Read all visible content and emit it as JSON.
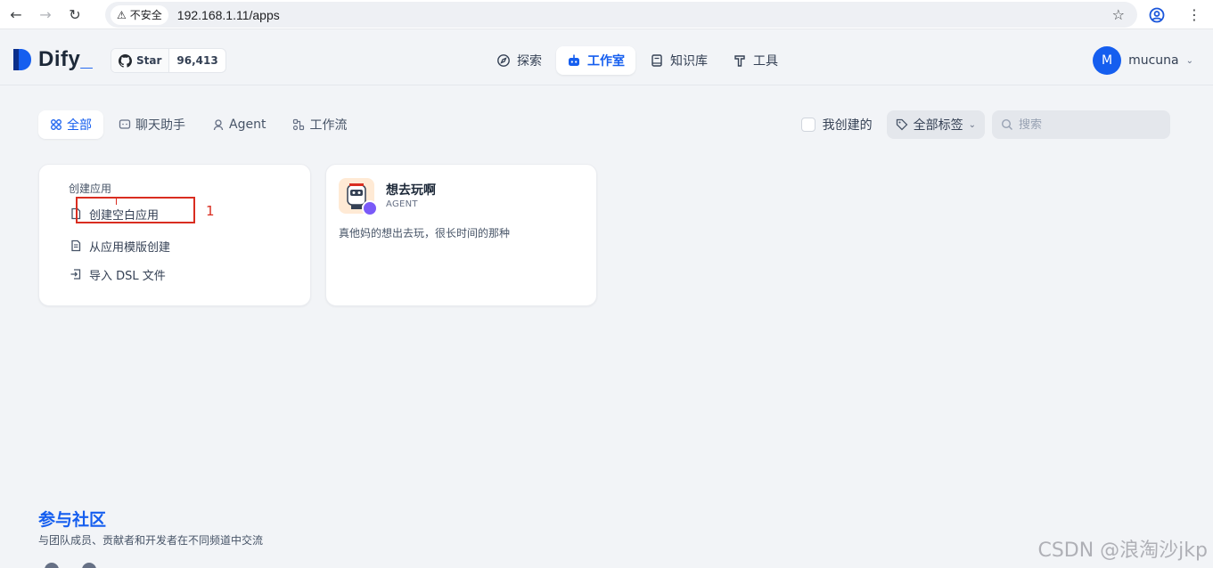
{
  "browser": {
    "security_label": "不安全",
    "url": "192.168.1.11/apps"
  },
  "header": {
    "logo_text": "Dify",
    "logo_suffix": "_",
    "github_star_label": "Star",
    "github_star_count": "96,413",
    "nav": [
      {
        "label": "探索",
        "icon": "compass-icon",
        "active": false
      },
      {
        "label": "工作室",
        "icon": "robot-icon",
        "active": true
      },
      {
        "label": "知识库",
        "icon": "book-icon",
        "active": false
      },
      {
        "label": "工具",
        "icon": "hammer-icon",
        "active": false
      }
    ],
    "user": {
      "avatar_letter": "M",
      "name": "mucuna"
    }
  },
  "tabs": [
    {
      "label": "全部",
      "icon": "grid-icon",
      "active": true
    },
    {
      "label": "聊天助手",
      "icon": "chat-icon",
      "active": false
    },
    {
      "label": "Agent",
      "icon": "agent-icon",
      "active": false
    },
    {
      "label": "工作流",
      "icon": "workflow-icon",
      "active": false
    }
  ],
  "filters": {
    "created_by_me_label": "我创建的",
    "created_by_me_checked": false,
    "tags_label": "全部标签",
    "search_placeholder": "搜索"
  },
  "create_card": {
    "title": "创建应用",
    "items": [
      {
        "label": "创建空白应用",
        "icon": "blank-file-icon"
      },
      {
        "label": "从应用模版创建",
        "icon": "template-file-icon"
      },
      {
        "label": "导入 DSL 文件",
        "icon": "import-icon"
      }
    ],
    "annotation_number": "1"
  },
  "apps": [
    {
      "name": "想去玩啊",
      "type": "AGENT",
      "description": "真他妈的想出去玩，很长时间的那种"
    }
  ],
  "footer": {
    "community_title": "参与社区",
    "community_subtitle": "与团队成员、贡献者和开发者在不同频道中交流"
  },
  "watermark": "CSDN @浪淘沙jkp",
  "colors": {
    "accent": "#155eef",
    "annotation": "#d92d20",
    "agent_badge": "#7a5af8"
  }
}
